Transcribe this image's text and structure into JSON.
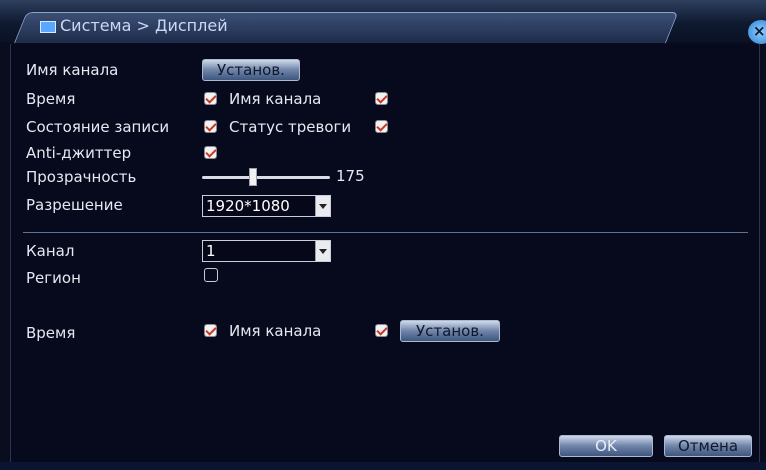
{
  "window": {
    "title": "Система > Дисплей",
    "close_symbol": "×"
  },
  "display": {
    "channel_name_label": "Имя канала",
    "channel_name_button": "Установ.",
    "time_label": "Время",
    "time_checked": true,
    "time_channel_name_label": "Имя канала",
    "time_channel_name_checked": true,
    "record_status_label": "Состояние записи",
    "record_status_checked": true,
    "alarm_status_label": "Статус тревоги",
    "alarm_status_checked": true,
    "anti_jitter_label": "Anti-джиттер",
    "anti_jitter_checked": true,
    "transparency_label": "Прозрачность",
    "transparency_value": "175",
    "transparency_level": 0.375,
    "resolution_label": "Разрешение",
    "resolution_value": "1920*1080"
  },
  "channel_section": {
    "channel_label": "Канал",
    "channel_value": "1",
    "region_label": "Регион",
    "region_checked": false,
    "time_label": "Время",
    "time_checked": true,
    "channel_name_label": "Имя канала",
    "channel_name_checked": true,
    "set_button": "Установ."
  },
  "footer": {
    "ok_label": "OK",
    "cancel_label": "Отмена"
  },
  "colors": {
    "background": "#07091c",
    "text": "#e6e9f2",
    "check_mark": "#c63a2a",
    "button_accent": "#6e84a8"
  }
}
